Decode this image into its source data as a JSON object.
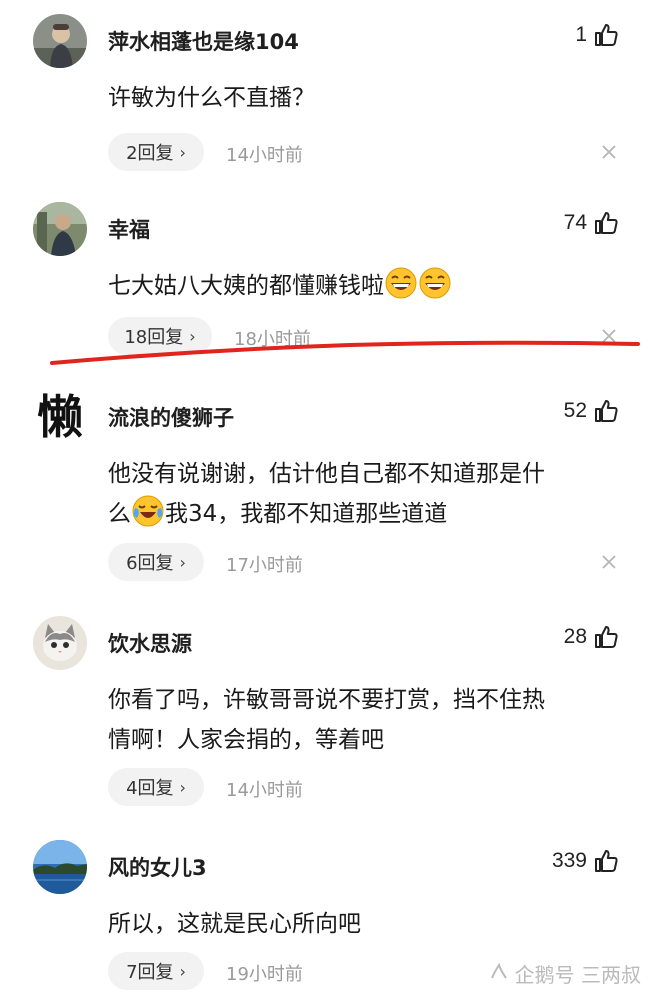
{
  "comments": [
    {
      "username": "萍水相蓬也是缘104",
      "likes": "1",
      "text": "许敏为什么不直播？",
      "replies": "2回复",
      "time": "14小时前",
      "avatar_icon": "avatar-person-photo"
    },
    {
      "username": "幸福",
      "likes": "74",
      "text_before": "七大姑八大姨的都懂赚钱啦",
      "emoji": "laughing-emoji",
      "replies": "18回复",
      "time": "18小时前",
      "avatar_icon": "avatar-person-outdoor-photo"
    },
    {
      "username": "流浪的傻狮子",
      "likes": "52",
      "text_line1": "他没有说谢谢，估计他自己都不知道那是什",
      "text_line2_a": "么",
      "text_line2_b": "我34，我都不知道那些道道",
      "emoji": "crying-laughing-emoji",
      "replies": "6回复",
      "time": "17小时前",
      "avatar_glyph": "懒"
    },
    {
      "username": "饮水思源",
      "likes": "28",
      "text_line1": "你看了吗，许敏哥哥说不要打赏，挡不住热",
      "text_line2": "情啊！人家会捐的，等着吧",
      "replies": "4回复",
      "time": "14小时前",
      "avatar_icon": "avatar-cat-photo"
    },
    {
      "username": "风的女儿3",
      "likes": "339",
      "text": "所以，这就是民心所向吧",
      "replies": "7回复",
      "time": "19小时前",
      "avatar_icon": "avatar-lake-photo"
    }
  ],
  "watermark": "企鹅号 三两叔",
  "colors": {
    "annotation_red": "#e0241e",
    "reply_pill_bg": "#f2f2f2",
    "time_gray": "#9a9a9a"
  },
  "icons": {
    "like": "thumbs-up-icon",
    "close": "close-icon",
    "chevron": "chevron-right-icon"
  }
}
